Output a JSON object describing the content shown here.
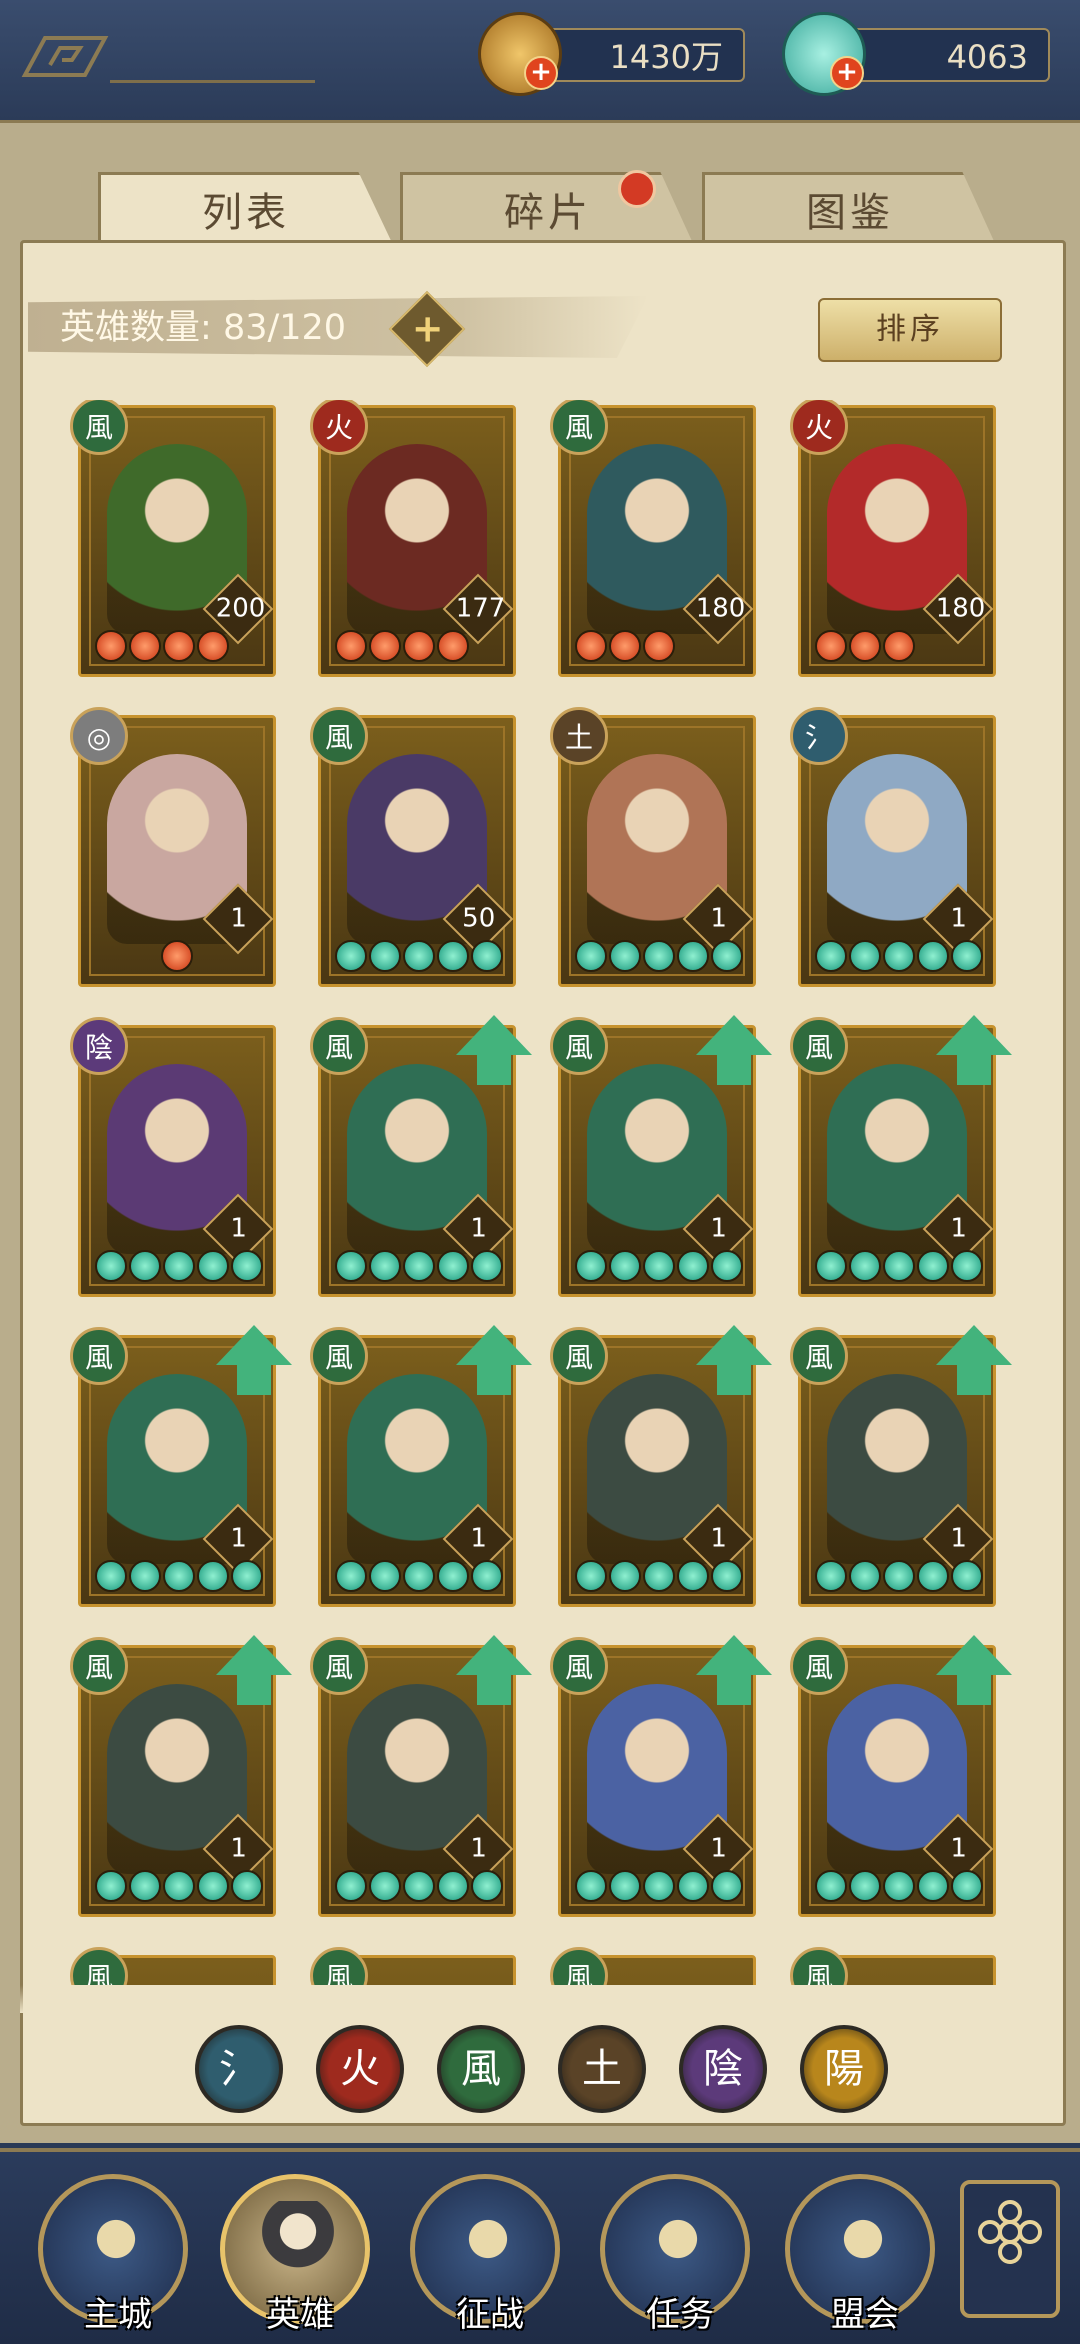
{
  "resources": {
    "coins": "1430万",
    "jade": "4063"
  },
  "tabs": [
    {
      "label": "列表",
      "active": true
    },
    {
      "label": "碎片",
      "active": false,
      "has_alert": true
    },
    {
      "label": "图鉴",
      "active": false
    }
  ],
  "hero_count": {
    "label": "英雄数量:",
    "value": "83/120"
  },
  "sort_label": "排序",
  "heroes": [
    {
      "element": "wind",
      "level": "200",
      "orbs": "red",
      "orb_count": 4,
      "upgrade": false,
      "tone": "#3f6a2a"
    },
    {
      "element": "fire",
      "level": "177",
      "orbs": "red",
      "orb_count": 4,
      "upgrade": false,
      "tone": "#6c2a22"
    },
    {
      "element": "wind",
      "level": "180",
      "orbs": "red",
      "orb_count": 3,
      "upgrade": false,
      "tone": "#2f5a5e"
    },
    {
      "element": "fire",
      "level": "180",
      "orbs": "red",
      "orb_count": 3,
      "upgrade": false,
      "tone": "#b32a2a"
    },
    {
      "element": "cloud",
      "level": "1",
      "orbs": "red",
      "orb_count": 1,
      "upgrade": false,
      "tone": "#c9a7a0"
    },
    {
      "element": "wind",
      "level": "50",
      "orbs": "green",
      "orb_count": 5,
      "upgrade": false,
      "tone": "#4a3a66"
    },
    {
      "element": "earth",
      "level": "1",
      "orbs": "green",
      "orb_count": 5,
      "upgrade": false,
      "tone": "#b07456"
    },
    {
      "element": "water",
      "level": "1",
      "orbs": "green",
      "orb_count": 5,
      "upgrade": false,
      "tone": "#8fa9c4"
    },
    {
      "element": "yin",
      "level": "1",
      "orbs": "green",
      "orb_count": 5,
      "upgrade": false,
      "tone": "#5b3a74"
    },
    {
      "element": "wind",
      "level": "1",
      "orbs": "green",
      "orb_count": 5,
      "upgrade": true,
      "tone": "#2f6e54"
    },
    {
      "element": "wind",
      "level": "1",
      "orbs": "green",
      "orb_count": 5,
      "upgrade": true,
      "tone": "#2f6e54"
    },
    {
      "element": "wind",
      "level": "1",
      "orbs": "green",
      "orb_count": 5,
      "upgrade": true,
      "tone": "#2f6e54"
    },
    {
      "element": "wind",
      "level": "1",
      "orbs": "green",
      "orb_count": 5,
      "upgrade": true,
      "tone": "#2f6e54"
    },
    {
      "element": "wind",
      "level": "1",
      "orbs": "green",
      "orb_count": 5,
      "upgrade": true,
      "tone": "#2f6e54"
    },
    {
      "element": "wind",
      "level": "1",
      "orbs": "green",
      "orb_count": 5,
      "upgrade": true,
      "tone": "#3c4b42"
    },
    {
      "element": "wind",
      "level": "1",
      "orbs": "green",
      "orb_count": 5,
      "upgrade": true,
      "tone": "#3c4b42"
    },
    {
      "element": "wind",
      "level": "1",
      "orbs": "green",
      "orb_count": 5,
      "upgrade": true,
      "tone": "#3c4b42"
    },
    {
      "element": "wind",
      "level": "1",
      "orbs": "green",
      "orb_count": 5,
      "upgrade": true,
      "tone": "#3c4b42"
    },
    {
      "element": "wind",
      "level": "1",
      "orbs": "green",
      "orb_count": 5,
      "upgrade": true,
      "tone": "#4b62a3"
    },
    {
      "element": "wind",
      "level": "1",
      "orbs": "green",
      "orb_count": 5,
      "upgrade": true,
      "tone": "#4b62a3"
    }
  ],
  "element_colors": {
    "water": "#2f5d6e",
    "fire": "#9e2a1e",
    "wind": "#2f6b3d",
    "earth": "#5a4327",
    "yin": "#5c3a7a",
    "yang": "#b8861c",
    "cloud": "#7d7d7d"
  },
  "element_filters": [
    "water",
    "fire",
    "wind",
    "earth",
    "yin",
    "yang"
  ],
  "nav": [
    {
      "label": "主城",
      "icon": "castle-icon"
    },
    {
      "label": "英雄",
      "icon": "hero-icon"
    },
    {
      "label": "征战",
      "icon": "battle-icon"
    },
    {
      "label": "任务",
      "icon": "task-icon"
    },
    {
      "label": "盟会",
      "icon": "guild-icon"
    }
  ]
}
